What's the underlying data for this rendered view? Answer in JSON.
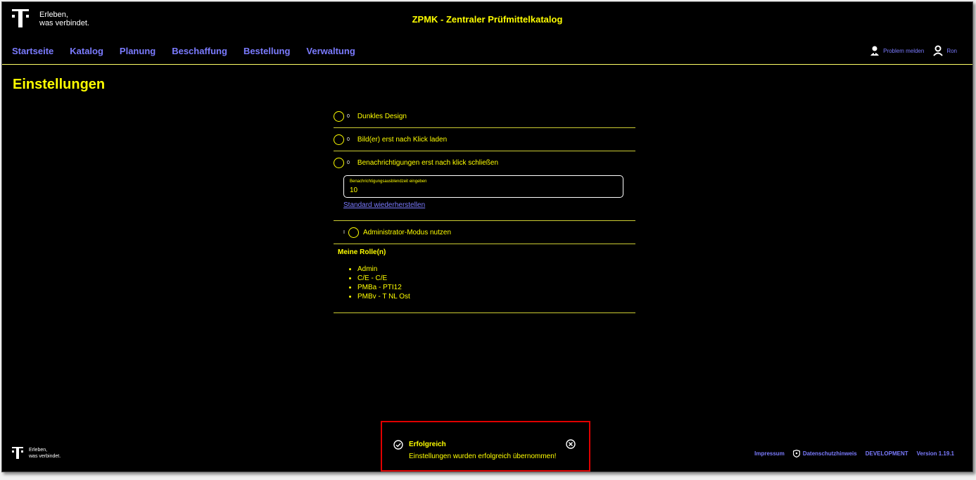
{
  "header": {
    "logo_line1": "Erleben,",
    "logo_line2": "was verbindet.",
    "app_title": "ZPMK - Zentraler Prüfmittelkatalog",
    "nav": [
      "Startseite",
      "Katalog",
      "Planung",
      "Beschaffung",
      "Bestellung",
      "Verwaltung"
    ],
    "report_problem": "Problem melden",
    "user": "Ron"
  },
  "page": {
    "title": "Einstellungen"
  },
  "settings": {
    "dark_design": {
      "state": "0",
      "label": "Dunkles Design"
    },
    "images_on_click": {
      "state": "0",
      "label": "Bild(er) erst nach Klick laden"
    },
    "notifications_on_click": {
      "state": "0",
      "label": "Benachrichtigungen erst nach klick schließen"
    },
    "timeout_field": {
      "label": "Benachrichtigungsausblendzeit eingeben",
      "value": "10"
    },
    "restore_default": "Standard wiederherstellen",
    "admin_mode": {
      "state": "I",
      "label": "Administrator-Modus nutzen"
    }
  },
  "roles": {
    "title": "Meine Rolle(n)",
    "items": [
      "Admin",
      "C/E - C/E",
      "PMBa - PTI12",
      "PMBv - T NL Ost"
    ]
  },
  "footer": {
    "logo_line1": "Erleben,",
    "logo_line2": "was verbindet.",
    "impressum": "Impressum",
    "privacy": "Datenschutzhinweis",
    "environment": "DEVELOPMENT",
    "version": "Version 1.19.1"
  },
  "toast": {
    "title": "Erfolgreich",
    "message": "Einstellungen wurden erfolgreich übernommen!",
    "icon": "check-circle-icon",
    "close_icon": "close-circle-icon",
    "border_color": "#e00000"
  },
  "colors": {
    "accent": "#ffff00",
    "link": "#7b7bff",
    "background": "#000000"
  }
}
